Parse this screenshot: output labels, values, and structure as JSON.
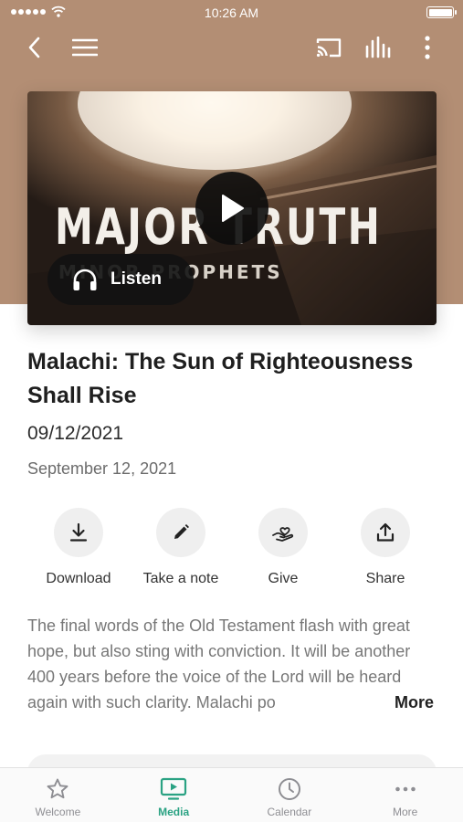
{
  "status_bar": {
    "time": "10:26 AM"
  },
  "toolbar": {
    "icons": [
      "back-icon",
      "menu-icon",
      "cast-icon",
      "audio-bars-icon",
      "more-vertical-icon"
    ]
  },
  "media": {
    "cover_title": "MAJOR TRUTH",
    "cover_subtitle": "MINOR PROPHETS",
    "listen_label": "Listen",
    "play_icon": "play-icon"
  },
  "sermon": {
    "title": "Malachi: The Sun of Righteousness Shall Rise",
    "date_short": "09/12/2021",
    "date_long": "September 12, 2021",
    "description": "The final words of the Old Testament flash with great hope, but also sting with conviction. It will be another 400 years before the voice of the Lord will be heard again with such clarity. Malachi po",
    "more_label": "More"
  },
  "actions": [
    {
      "label": "Download",
      "icon": "download-icon"
    },
    {
      "label": "Take a note",
      "icon": "pencil-icon"
    },
    {
      "label": "Give",
      "icon": "give-heart-hand-icon"
    },
    {
      "label": "Share",
      "icon": "share-icon"
    }
  ],
  "tabs": [
    {
      "label": "Welcome",
      "icon": "star-icon",
      "active": false
    },
    {
      "label": "Media",
      "icon": "tv-play-icon",
      "active": true
    },
    {
      "label": "Calendar",
      "icon": "clock-icon",
      "active": false
    },
    {
      "label": "More",
      "icon": "ellipsis-icon",
      "active": false
    }
  ],
  "colors": {
    "header_background": "#b38e74",
    "accent": "#2aa283",
    "action_circle": "#efefef",
    "tab_inactive": "#8e8e93"
  }
}
